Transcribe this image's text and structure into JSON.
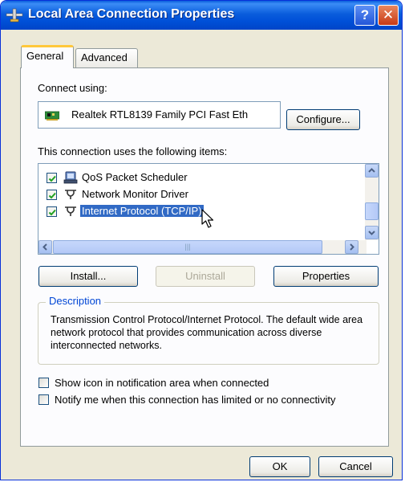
{
  "window": {
    "title": "Local Area Connection Properties",
    "help_label": "?",
    "close_label": "✕"
  },
  "tabs": [
    {
      "label": "General",
      "active": true
    },
    {
      "label": "Advanced",
      "active": false
    }
  ],
  "general": {
    "connect_using_label": "Connect using:",
    "adapter_name": "Realtek RTL8139 Family PCI Fast Eth",
    "configure_label": "Configure...",
    "items_label": "This connection uses the following items:",
    "items": [
      {
        "label": "QoS Packet Scheduler",
        "checked": true,
        "icon": "qos-scheduler-icon"
      },
      {
        "label": "Network Monitor Driver",
        "checked": true,
        "icon": "network-protocol-icon"
      },
      {
        "label": "Internet Protocol (TCP/IP)",
        "checked": true,
        "selected": true,
        "icon": "network-protocol-icon"
      }
    ],
    "hscroll_grip": "|||",
    "install_label": "Install...",
    "uninstall_label": "Uninstall",
    "properties_label": "Properties",
    "description_title": "Description",
    "description_text": "Transmission Control Protocol/Internet Protocol. The default wide area network protocol that provides communication across diverse interconnected networks.",
    "show_icon_label": "Show icon in notification area when connected",
    "show_icon_checked": false,
    "notify_label": "Notify me when this connection has limited or no connectivity",
    "notify_checked": false
  },
  "footer": {
    "ok_label": "OK",
    "cancel_label": "Cancel"
  },
  "colors": {
    "titlebar": "#0a5ddc",
    "selection": "#316ac5",
    "dialog_bg": "#ece9d8",
    "group_title": "#0046d5"
  }
}
